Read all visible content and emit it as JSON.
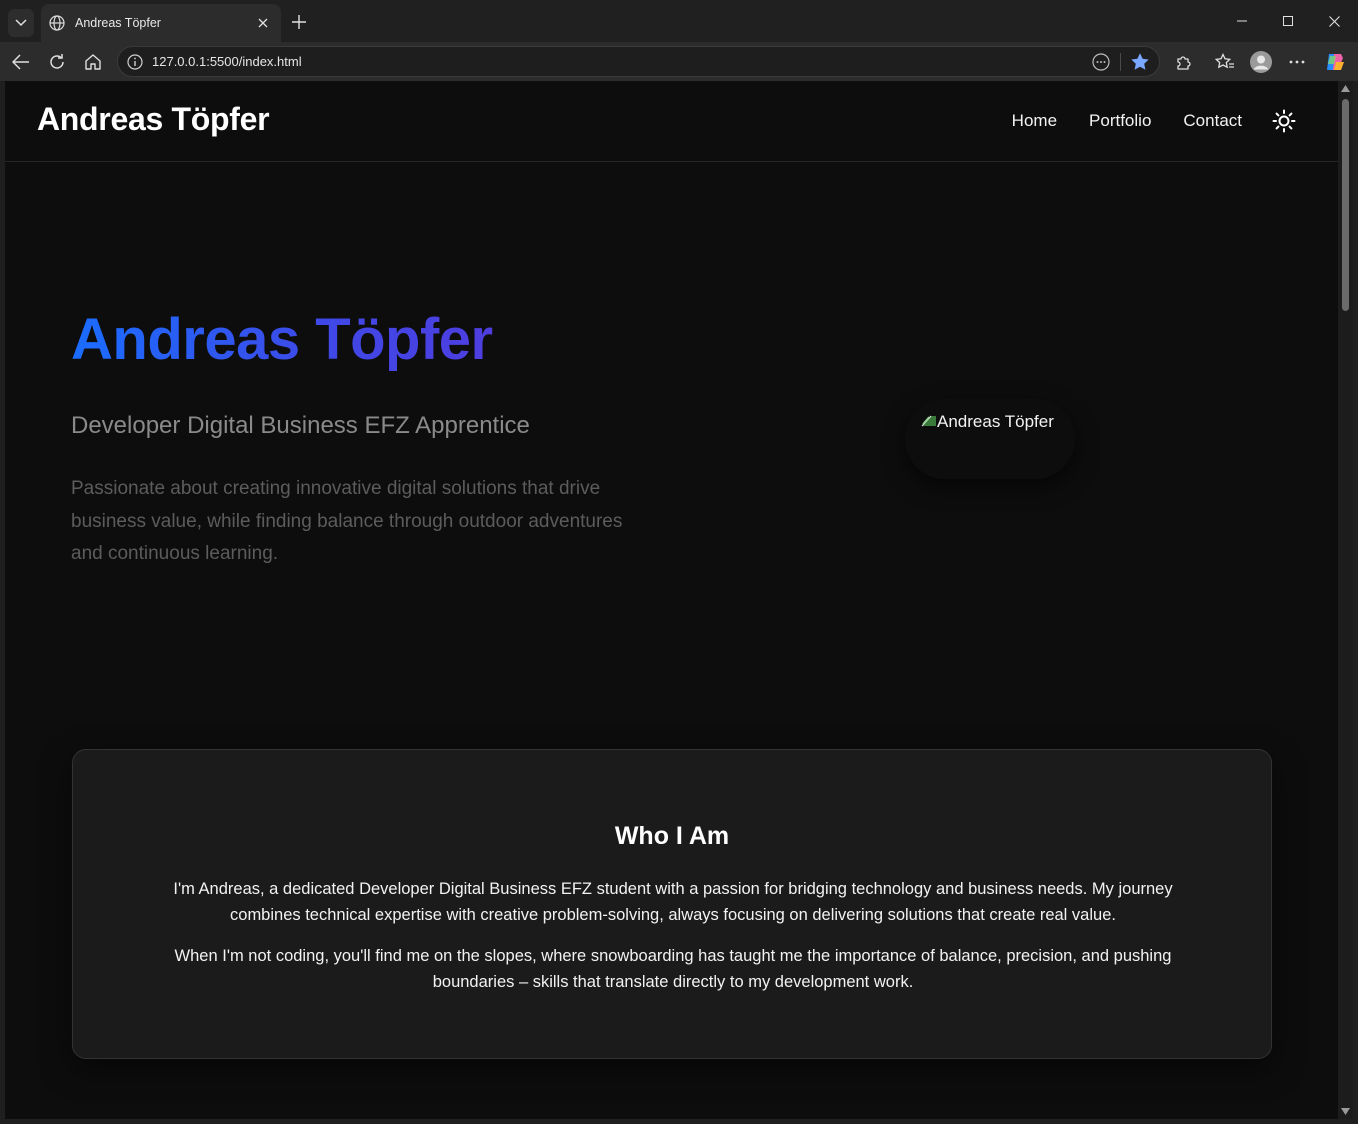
{
  "browser": {
    "tab_title": "Andreas Töpfer",
    "url": "127.0.0.1:5500/index.html"
  },
  "site": {
    "logo": "Andreas Töpfer",
    "nav": [
      "Home",
      "Portfolio",
      "Contact"
    ],
    "theme_toggle_icon": "sun-icon"
  },
  "hero": {
    "name": "Andreas Töpfer",
    "subtitle": "Developer Digital Business EFZ Apprentice",
    "description": "Passionate about creating innovative digital solutions that drive business value, while finding balance through outdoor adventures and continuous learning.",
    "image_alt": "Andreas Töpfer"
  },
  "about": {
    "title": "Who I Am",
    "p1": "I'm Andreas, a dedicated Developer Digital Business EFZ student with a passion for bridging technology and business needs. My journey combines technical expertise with creative problem-solving, always focusing on delivering solutions that create real value.",
    "p2": "When I'm not coding, you'll find me on the slopes, where snowboarding has taught me the importance of balance, precision, and pushing boundaries – skills that translate directly to my development work."
  },
  "colors": {
    "page_bg": "#0d0d0d",
    "card_bg": "#1b1b1b",
    "gradient_start": "#1a6dff",
    "gradient_end": "#4e3ee0",
    "bookmark_star": "#7aa7ff"
  }
}
